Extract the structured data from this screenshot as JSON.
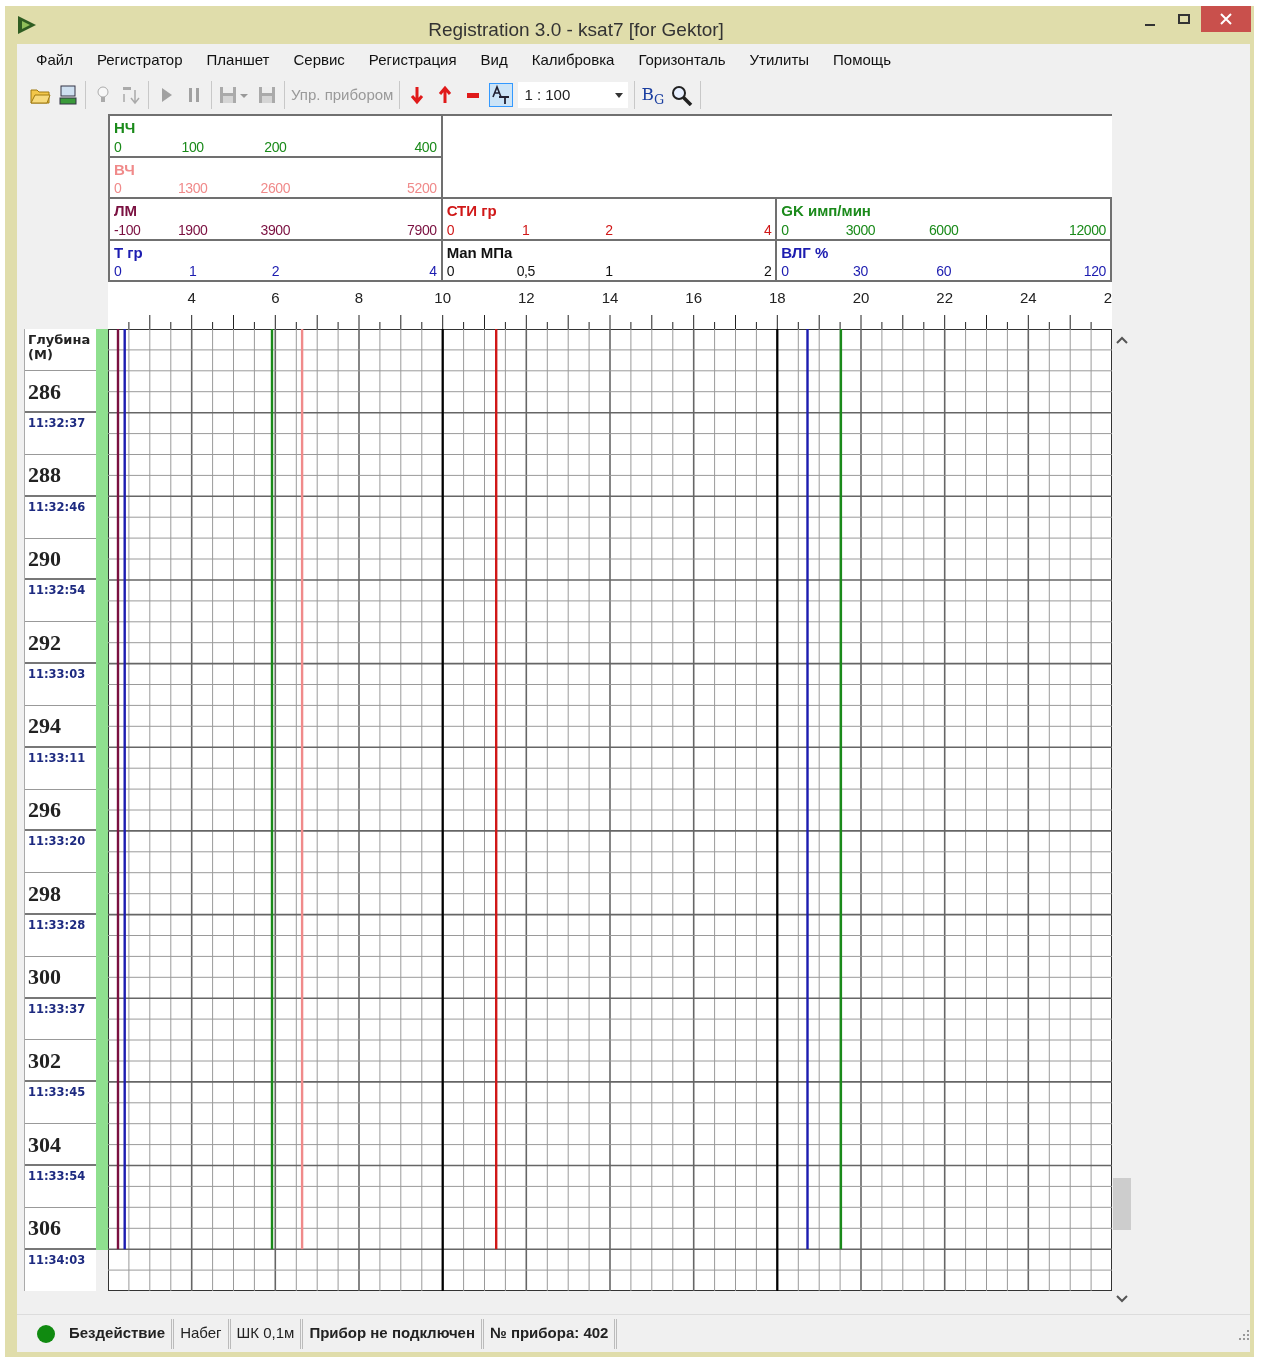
{
  "window": {
    "title": "Registration 3.0 - ksat7 [for Gektor]"
  },
  "menu": [
    "Файл",
    "Регистратор",
    "Планшет",
    "Сервис",
    "Регистрация",
    "Вид",
    "Калибровка",
    "Горизонталь",
    "Утилиты",
    "Помощь"
  ],
  "toolbar": [
    [
      {
        "kind": "icon",
        "disabled": false,
        "selected": false
      },
      {
        "kind": "icon",
        "disabled": false,
        "selected": false
      }
    ],
    [
      {
        "kind": "icon",
        "disabled": true,
        "selected": false
      },
      {
        "kind": "icon",
        "disabled": true,
        "selected": false
      }
    ],
    [
      {
        "kind": "icon",
        "disabled": true,
        "selected": false
      },
      {
        "kind": "icon",
        "disabled": true,
        "selected": false
      }
    ],
    [
      {
        "kind": "icon",
        "disabled": true,
        "selected": false
      },
      {
        "kind": "icon",
        "disabled": true,
        "selected": false
      }
    ],
    [
      {
        "kind": "text",
        "label": "Упр. прибором",
        "disabled": true
      }
    ],
    [
      {
        "kind": "icon",
        "disabled": false,
        "selected": false
      },
      {
        "kind": "icon",
        "disabled": false,
        "selected": false
      },
      {
        "kind": "icon",
        "disabled": false,
        "selected": false
      },
      {
        "kind": "icon",
        "disabled": false,
        "selected": true
      },
      {
        "kind": "combo",
        "value": "1 : 100",
        "disabled": false
      }
    ],
    [
      {
        "kind": "glyph",
        "label": "B$_{G}$",
        "disabled": false
      },
      {
        "kind": "icon",
        "disabled": false,
        "selected": false
      }
    ]
  ],
  "scale_rows": [
    {
      "tracks": [
        {
          "name": "НЧ",
          "color": "#1a8a1a",
          "ticks": [
            "0",
            "100",
            "200",
            "400"
          ]
        }
      ]
    },
    {
      "tracks": [
        {
          "name": "ВЧ",
          "color": "#f08a8a",
          "ticks": [
            "0",
            "1300",
            "2600",
            "5200"
          ]
        }
      ]
    },
    {
      "tracks": [
        {
          "name": "ЛМ",
          "color": "#7a1040",
          "ticks": [
            "-100",
            "1900",
            "3900",
            "7900"
          ]
        },
        {
          "name": "СТИ гр",
          "color": "#d01818",
          "ticks": [
            "0",
            "1",
            "2",
            "4"
          ]
        },
        {
          "name": "GK имп/мин",
          "color": "#1a8a1a",
          "ticks": [
            "0",
            "3000",
            "6000",
            "12000"
          ]
        }
      ]
    },
    {
      "tracks": [
        {
          "name": "Т гр",
          "color": "#1c1cb0",
          "ticks": [
            "0",
            "1",
            "2",
            "4"
          ]
        },
        {
          "name": "Man МПа",
          "color": "#111111",
          "ticks": [
            "0",
            "0,5",
            "1",
            "2"
          ]
        },
        {
          "name": "ВЛГ %",
          "color": "#1c1cb0",
          "ticks": [
            "0",
            "30",
            "60",
            "120"
          ]
        }
      ]
    }
  ],
  "ruler": [
    "4",
    "6",
    "8",
    "10",
    "12",
    "14",
    "16",
    "18",
    "20",
    "22",
    "24",
    "2"
  ],
  "depth": {
    "title": "Глубина (М)",
    "marks": [
      {
        "depth": "286",
        "time": "11:32:37"
      },
      {
        "depth": "288",
        "time": "11:32:46"
      },
      {
        "depth": "290",
        "time": "11:32:54"
      },
      {
        "depth": "292",
        "time": "11:33:03"
      },
      {
        "depth": "294",
        "time": "11:33:11"
      },
      {
        "depth": "296",
        "time": "11:33:20"
      },
      {
        "depth": "298",
        "time": "11:33:28"
      },
      {
        "depth": "300",
        "time": "11:33:37"
      },
      {
        "depth": "302",
        "time": "11:33:45"
      },
      {
        "depth": "304",
        "time": "11:33:54"
      },
      {
        "depth": "306",
        "time": "11:34:03"
      }
    ]
  },
  "status_bar": [
    {
      "kind": "dot",
      "color": "#108a10"
    },
    {
      "kind": "text",
      "text": "Бездействие",
      "bold": true
    },
    {
      "kind": "text",
      "text": "Набег",
      "bold": false
    },
    {
      "kind": "text",
      "text": "ШК 0,1м",
      "bold": false
    },
    {
      "kind": "text",
      "text": "Прибор не подключен",
      "bold": true
    },
    {
      "kind": "text",
      "text": "№ прибора: 402",
      "bold": true
    }
  ]
}
